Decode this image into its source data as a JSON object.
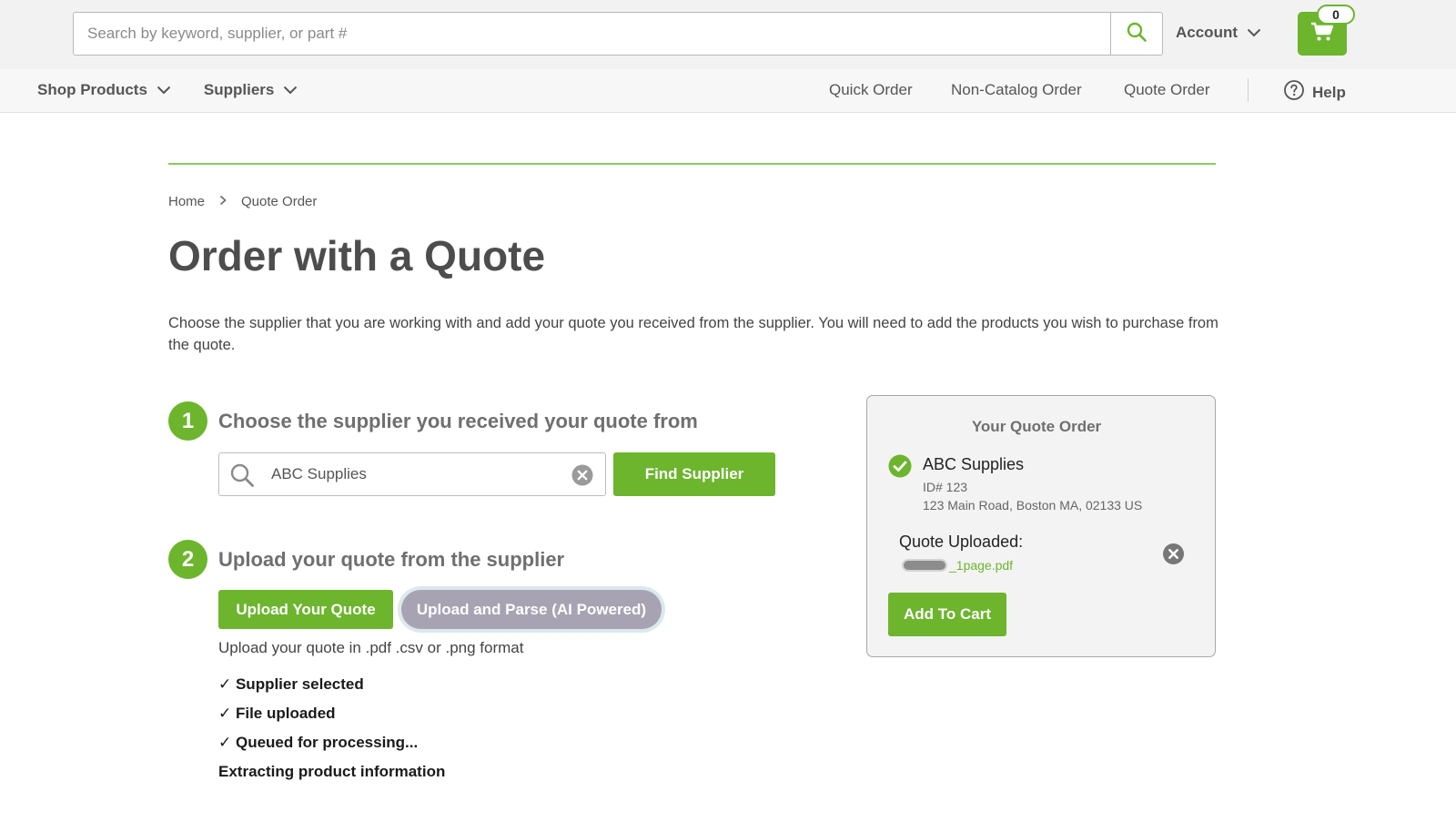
{
  "header": {
    "search_placeholder": "Search by keyword, supplier, or part #",
    "account_label": "Account",
    "cart_count": "0"
  },
  "nav": {
    "left_items": [
      {
        "label": "Shop Products"
      },
      {
        "label": "Suppliers"
      }
    ],
    "quick_order": "Quick Order",
    "non_catalog_order": "Non-Catalog Order",
    "quote_order": "Quote Order",
    "help": "Help"
  },
  "breadcrumb": {
    "home": "Home",
    "current": "Quote Order"
  },
  "page": {
    "title": "Order with a Quote",
    "intro": "Choose the supplier that you are working with and add your quote you received from the supplier. You will need to add the products you wish to purchase from the quote."
  },
  "step1": {
    "number": "1",
    "title": "Choose the supplier you received your quote from",
    "supplier_value": "ABC Supplies",
    "find_button": "Find Supplier"
  },
  "step2": {
    "number": "2",
    "title": "Upload your quote from the supplier",
    "upload_button": "Upload Your Quote",
    "ai_button": "Upload and Parse (AI Powered)",
    "help_text": "Upload your quote in .pdf .csv or .png format",
    "status": [
      "✓ Supplier selected",
      "✓ File uploaded",
      "✓ Queued for processing...",
      "Extracting product information"
    ]
  },
  "quote_panel": {
    "title": "Your Quote Order",
    "supplier_name": "ABC Supplies",
    "supplier_id": "ID# 123",
    "supplier_address": "123 Main Road, Boston MA, 02133 US",
    "uploaded_label": "Quote Uploaded:",
    "file_name_suffix": "_1page.pdf",
    "add_to_cart": "Add To Cart"
  },
  "colors": {
    "brand_green": "#6cb52d",
    "ai_button": "#a7a3b3"
  }
}
